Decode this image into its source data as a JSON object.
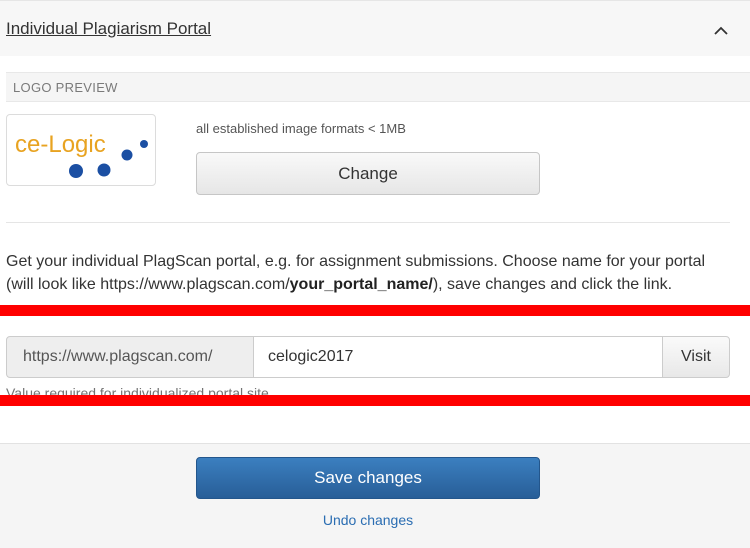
{
  "panel": {
    "title": "Individual Plagiarism Portal",
    "collapse_icon": "chevron-up-icon"
  },
  "logo": {
    "section_label": "LOGO PREVIEW",
    "text_part1": "ce-Logic",
    "formats_note": "all established image formats < 1MB",
    "change_label": "Change"
  },
  "portal": {
    "desc_part1": "Get your individual PlagScan portal, e.g. for assignment submissions. Choose name for your portal (will look like https://www.plagscan.com/",
    "desc_bold": "your_portal_name/",
    "desc_part2": "), save changes and click the link.",
    "url_prefix": "https://www.plagscan.com/",
    "portal_name_value": "celogic2017",
    "visit_label": "Visit",
    "help_text": "Value required for individualized portal site"
  },
  "footer": {
    "save_label": "Save changes",
    "undo_label": "Undo changes"
  },
  "colors": {
    "primary": "#2d6aa8",
    "link": "#2a6db2",
    "redaction": "#ff0000",
    "logo_orange": "#e8a321",
    "logo_blue": "#1b4fa3"
  }
}
